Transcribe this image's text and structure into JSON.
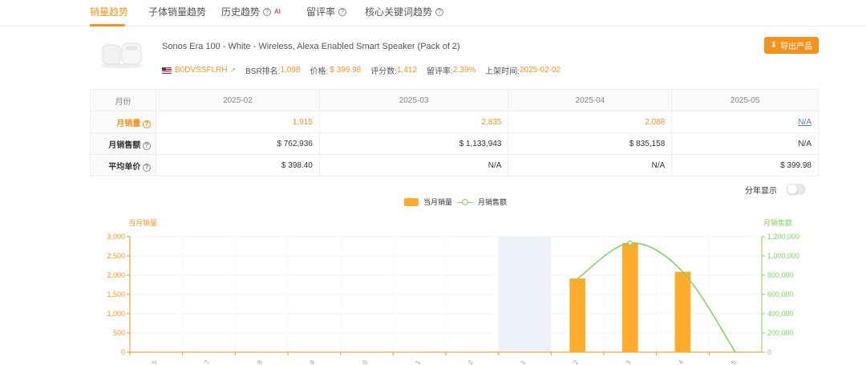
{
  "tabs": [
    {
      "label": "销量趋势",
      "active": true
    },
    {
      "label": "子体销量趋势",
      "active": false
    },
    {
      "label": "历史趋势",
      "active": false,
      "badge": "AI"
    },
    {
      "label": "留评率",
      "active": false
    },
    {
      "label": "核心关键词趋势",
      "active": false
    }
  ],
  "product": {
    "title": "Sonos Era 100 - White - Wireless, Alexa Enabled Smart Speaker (Pack of 2)",
    "asin": "B0DVSSFLRH",
    "bsr_label": "BSR排名:",
    "bsr": "1,098",
    "price_label": "价格:",
    "price": "$ 399.98",
    "reviews_label": "评分数:",
    "reviews": "1,412",
    "review_rate_label": "留评率:",
    "review_rate": "2.39%",
    "launch_label": "上架时间:",
    "launch": "2025-02-02"
  },
  "export_label": "导出产品",
  "table": {
    "header_label": "月份",
    "months": [
      "2025-02",
      "2025-03",
      "2025-04",
      "2025-05"
    ],
    "rows": [
      {
        "label": "月销量",
        "values": [
          "1,915",
          "2,835",
          "2,088",
          "N/A"
        ]
      },
      {
        "label": "月销售额",
        "values": [
          "$ 762,936",
          "$ 1,133,943",
          "$ 835,158",
          "N/A"
        ]
      },
      {
        "label": "平均单价",
        "values": [
          "$ 398.40",
          "N/A",
          "N/A",
          "$ 399.98"
        ]
      }
    ]
  },
  "toggle_label": "分年显示",
  "chart_data": {
    "type": "bar",
    "legend": [
      "当月销量",
      "月销售额"
    ],
    "yleft_label": "当月销量",
    "yright_label": "月销售额",
    "yleft_ticks": [
      "3,000",
      "2,500",
      "2,000",
      "1,500",
      "1,000",
      "500",
      "0"
    ],
    "yright_ticks": [
      "1,200,000",
      "1,000,000",
      "800,000",
      "600,000",
      "400,000",
      "200,000",
      "0"
    ],
    "ylim_left": [
      0,
      3000
    ],
    "ylim_right": [
      0,
      1200000
    ],
    "x_tick_labels": [
      "5",
      "7",
      "8",
      "9",
      "0",
      "1",
      "2",
      "1",
      "2",
      "3",
      "4",
      "5"
    ],
    "series": [
      {
        "name": "当月销量",
        "type": "bar",
        "values": [
          0,
          0,
          0,
          0,
          0,
          0,
          0,
          0,
          1915,
          2835,
          2088,
          0
        ]
      },
      {
        "name": "月销售额",
        "type": "line",
        "values": [
          null,
          null,
          null,
          null,
          null,
          null,
          null,
          null,
          762936,
          1133943,
          835158,
          0
        ]
      }
    ],
    "highlight_index": 7,
    "colors": {
      "bar": "#ffab2b",
      "line": "#7ed35d",
      "left_axis": "#f5921e",
      "right_axis": "#7ed35d",
      "highlight": "#eef1f7"
    }
  }
}
